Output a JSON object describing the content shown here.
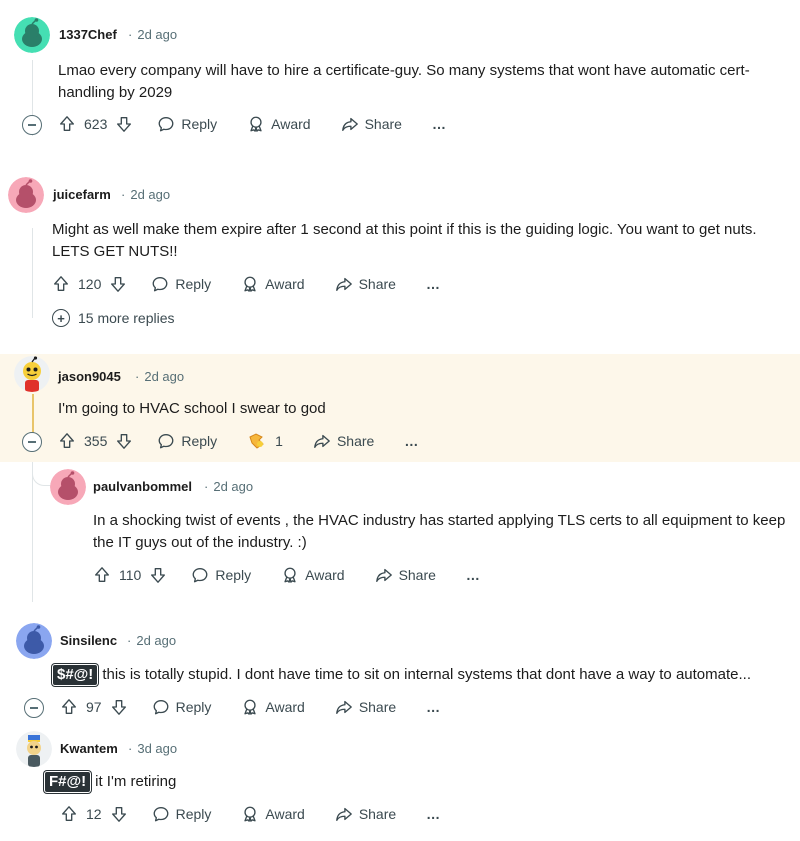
{
  "comments": [
    {
      "username": "1337Chef",
      "time": "2d ago",
      "text": "Lmao every company will have to hire a certificate-guy. So many systems that wont have automatic cert-handling by 2029",
      "votes": "623",
      "reply": "Reply",
      "award": "Award",
      "share": "Share",
      "more": "…"
    },
    {
      "username": "juicefarm",
      "time": "2d ago",
      "text": "Might as well make them expire after 1 second at this point if this is the guiding logic. You want to get nuts. LETS GET NUTS!!",
      "votes": "120",
      "reply": "Reply",
      "award": "Award",
      "share": "Share",
      "more": "…",
      "more_replies": "15 more replies"
    },
    {
      "username": "jason9045",
      "time": "2d ago",
      "text": "I'm going to HVAC school I swear to god",
      "votes": "355",
      "reply": "Reply",
      "award_count": "1",
      "share": "Share",
      "more": "…"
    },
    {
      "username": "paulvanbommel",
      "time": "2d ago",
      "text": "In a shocking twist of events , the HVAC industry has started applying TLS certs to all equipment to keep the IT guys out of the industry. :)",
      "votes": "110",
      "reply": "Reply",
      "award": "Award",
      "share": "Share",
      "more": "…"
    },
    {
      "username": "Sinsilenc",
      "time": "2d ago",
      "badge": "$#@!",
      "text": "this is totally stupid. I dont have time to sit on internal systems that dont have a way to automate...",
      "votes": "97",
      "reply": "Reply",
      "award": "Award",
      "share": "Share",
      "more": "…"
    },
    {
      "username": "Kwantem",
      "time": "3d ago",
      "badge": "F#@!",
      "text": "it I'm retiring",
      "votes": "12",
      "reply": "Reply",
      "award": "Award",
      "share": "Share",
      "more": "…"
    }
  ],
  "dot": "·",
  "icons": {
    "upvote": "upvote-icon",
    "downvote": "downvote-icon",
    "reply": "reply-icon",
    "award": "award-icon",
    "share": "share-icon",
    "collapse": "collapse-icon",
    "expand": "expand-icon"
  },
  "colors": {
    "meta_gray": "#576f76",
    "highlight_bg": "#fdf7ea",
    "avatar_teal": "#3ee0b5",
    "avatar_pink": "#f7a8b8",
    "avatar_blue": "#8aa6f0"
  }
}
